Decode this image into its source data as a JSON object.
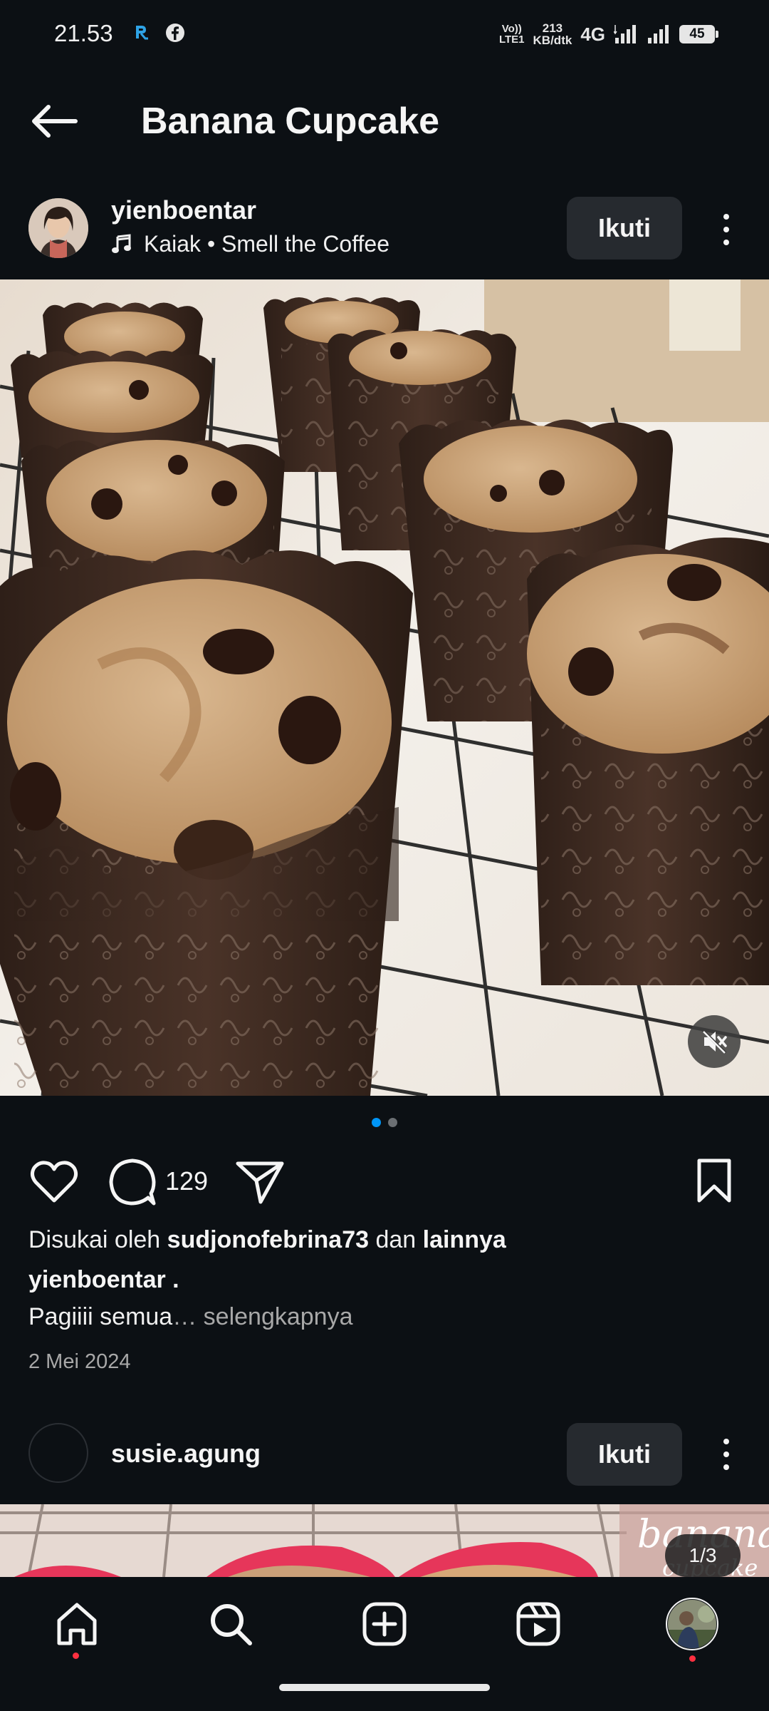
{
  "status_bar": {
    "time": "21.53",
    "volte_line1": "Vo))",
    "volte_line2": "LTE1",
    "speed_value": "213",
    "speed_unit": "KB/dtk",
    "network": "4G",
    "battery": "45",
    "app_icons": [
      "notification-app-icon",
      "facebook-icon"
    ]
  },
  "header": {
    "title": "Banana Cupcake",
    "back_icon": "arrow-left-icon"
  },
  "post": {
    "username": "yienboentar",
    "audio": "Kaiak • Smell the Coffee",
    "follow_label": "Ikuti",
    "comment_count": "129",
    "likes_prefix": "Disukai oleh ",
    "likes_user": "sudjonofebrina73",
    "likes_middle": " dan ",
    "likes_others": "lainnya",
    "caption_user": "yienboentar .",
    "caption_text": "Pagiiii semua",
    "caption_more": "… selengkapnya",
    "date": "2 Mei 2024",
    "carousel_pages": 2,
    "carousel_active": 1
  },
  "post2": {
    "username": "susie.agung",
    "follow_label": "Ikuti",
    "image_text_1": "banana",
    "image_text_2": "cupcake",
    "counter": "1/3"
  },
  "nav": {
    "items": [
      "home-icon",
      "search-icon",
      "create-icon",
      "reels-icon",
      "profile-avatar"
    ],
    "accent": "#ff3040"
  },
  "colors": {
    "background": "#0c1014",
    "button": "#262a2f",
    "active_dot": "#0095f6",
    "secondary_text": "#a8a8a8"
  }
}
